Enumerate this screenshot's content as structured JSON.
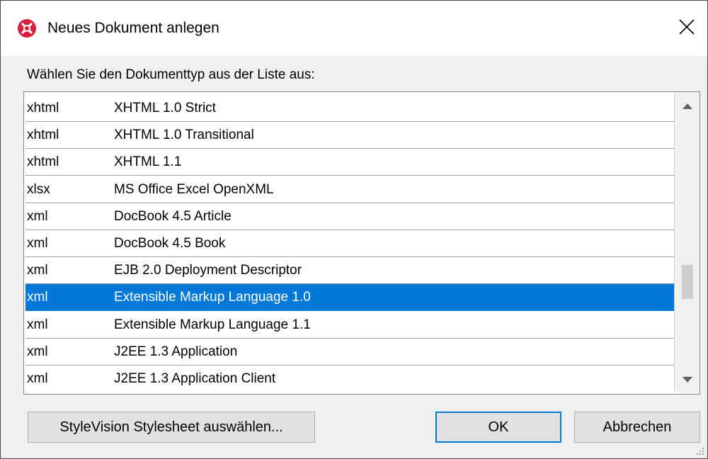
{
  "window": {
    "title": "Neues Dokument anlegen",
    "icon": "altova-app-icon",
    "close_icon": "close-icon"
  },
  "prompt": "Wählen Sie den Dokumenttyp aus der Liste aus:",
  "list": {
    "rows": [
      {
        "ext": "xhtml",
        "desc": "XHTML 1.0 Strict",
        "selected": false
      },
      {
        "ext": "xhtml",
        "desc": "XHTML 1.0 Transitional",
        "selected": false
      },
      {
        "ext": "xhtml",
        "desc": "XHTML 1.1",
        "selected": false
      },
      {
        "ext": "xlsx",
        "desc": "MS Office Excel OpenXML",
        "selected": false
      },
      {
        "ext": "xml",
        "desc": "DocBook 4.5 Article",
        "selected": false
      },
      {
        "ext": "xml",
        "desc": "DocBook 4.5 Book",
        "selected": false
      },
      {
        "ext": "xml",
        "desc": "EJB 2.0 Deployment Descriptor",
        "selected": false
      },
      {
        "ext": "xml",
        "desc": "Extensible Markup Language 1.0",
        "selected": true
      },
      {
        "ext": "xml",
        "desc": "Extensible Markup Language 1.1",
        "selected": false
      },
      {
        "ext": "xml",
        "desc": "J2EE 1.3 Application",
        "selected": false
      },
      {
        "ext": "xml",
        "desc": "J2EE 1.3 Application Client",
        "selected": false
      }
    ],
    "selection_color": "#0078d7"
  },
  "buttons": {
    "stylevision": "StyleVision Stylesheet auswählen...",
    "ok": "OK",
    "cancel": "Abbrechen"
  },
  "accent_color": "#0078d7",
  "brand_color": "#d8203a"
}
